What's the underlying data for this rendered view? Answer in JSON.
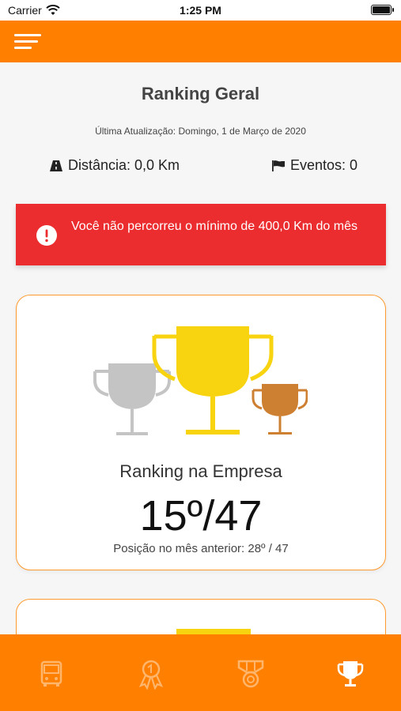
{
  "status_bar": {
    "carrier": "Carrier",
    "time": "1:25 PM"
  },
  "header": {
    "menu_icon": "hamburger-icon"
  },
  "page": {
    "title": "Ranking Geral",
    "last_update": "Última Atualização: Domingo, 1 de Março de 2020"
  },
  "stats": {
    "distance_label": "Distância: 0,0 Km",
    "events_label": "Eventos: 0"
  },
  "alert": {
    "message": "Você não percorreu o mínimo de 400,0 Km do mês",
    "color": "#ec2d2f"
  },
  "ranking_card": {
    "title": "Ranking na Empresa",
    "position": "15º/47",
    "previous": "Posição no mês anterior: 28º / 47"
  },
  "tabs": [
    {
      "name": "bus-icon",
      "active": false
    },
    {
      "name": "award-ribbon-icon",
      "active": false
    },
    {
      "name": "medal-icon",
      "active": false
    },
    {
      "name": "trophy-icon",
      "active": true
    }
  ],
  "colors": {
    "primary": "#ff8000",
    "gold": "#f8d30f",
    "silver": "#c4c4c4",
    "bronze": "#cd7f32",
    "tab_inactive": "#ffb56b",
    "tab_active": "#ffffff"
  }
}
